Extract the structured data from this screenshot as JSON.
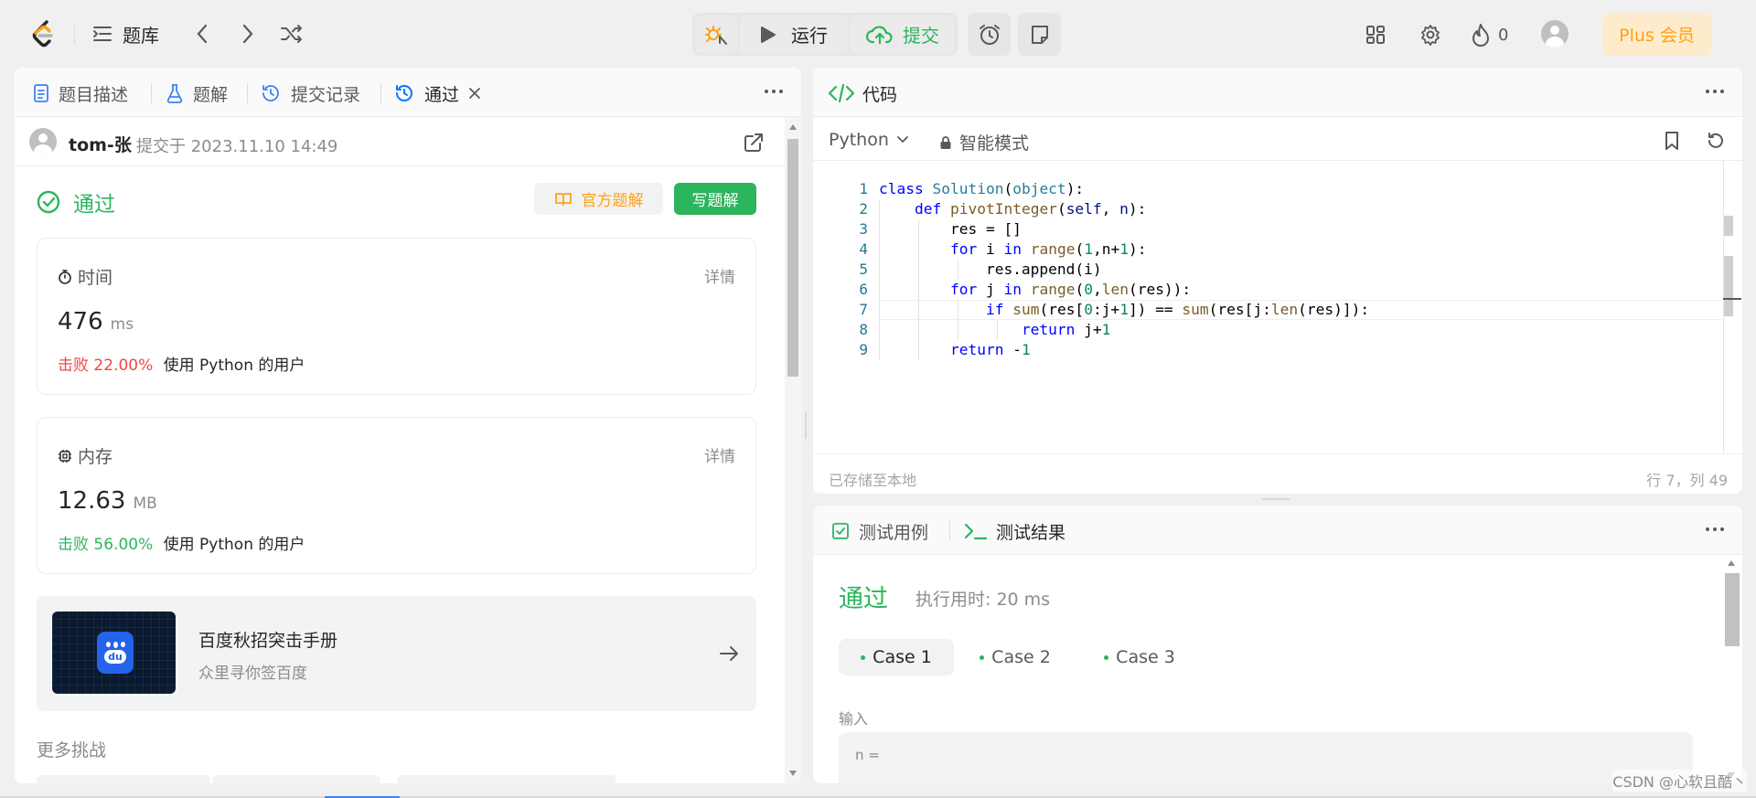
{
  "topbar": {
    "problems_label": "题库",
    "run_label": "运行",
    "submit_label": "提交",
    "fire_count": "0",
    "plus_label": "Plus 会员"
  },
  "left_tabs": [
    {
      "label": "题目描述"
    },
    {
      "label": "题解"
    },
    {
      "label": "提交记录"
    },
    {
      "label": "通过"
    }
  ],
  "submission": {
    "user": "tom-张",
    "submitted_at": "提交于 2023.11.10 14:49",
    "status": "通过",
    "official_solution_label": "官方题解",
    "write_solution_label": "写题解"
  },
  "time_card": {
    "title": "时间",
    "detail": "详情",
    "value": "476",
    "unit": "ms",
    "beat_label": "击败 22.00%",
    "beat_suffix": "使用 Python 的用户"
  },
  "memory_card": {
    "title": "内存",
    "detail": "详情",
    "value": "12.63",
    "unit": "MB",
    "beat_label": "击败 56.00%",
    "beat_suffix": "使用 Python 的用户"
  },
  "ad": {
    "title": "百度秋招突击手册",
    "subtitle": "众里寻你签百度",
    "logo_text": "du"
  },
  "more_challenges": "更多挑战",
  "code_panel": {
    "title": "代码",
    "language": "Python",
    "mode": "智能模式",
    "saved": "已存储至本地",
    "cursor": "行 7，列 49"
  },
  "code_lines": [
    "1",
    "2",
    "3",
    "4",
    "5",
    "6",
    "7",
    "8",
    "9"
  ],
  "test_panel": {
    "tab_cases": "测试用例",
    "tab_results": "测试结果",
    "status": "通过",
    "runtime": "执行用时: 20 ms",
    "cases": [
      "Case 1",
      "Case 2",
      "Case 3"
    ],
    "input_label": "输入",
    "input_value": "n ="
  },
  "watermark": "CSDN @心软且酷丶",
  "colors": {
    "accent_green": "#2db55d",
    "fail_red": "#ef4743",
    "plus_orange": "#ffa116",
    "tab_blue": "#007aff"
  }
}
